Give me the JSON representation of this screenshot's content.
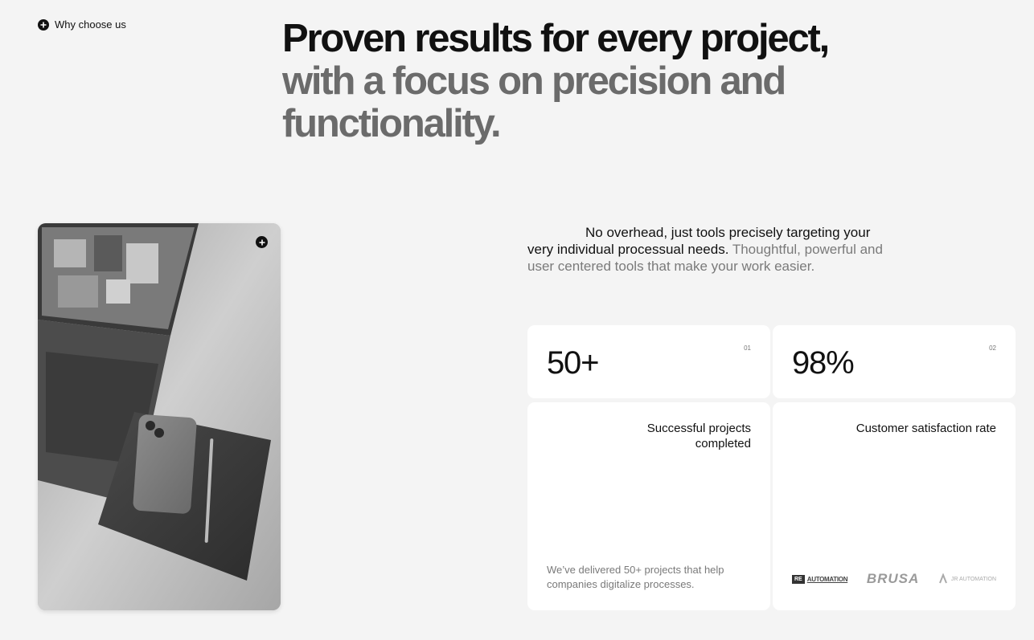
{
  "section": {
    "eyebrow": "Why choose us",
    "headline_dark": "Proven results for every project,",
    "headline_muted": "with a focus on precision and functionality."
  },
  "intro": {
    "lead": "No overhead, just tools precisely targeting your very individual processual needs.",
    "rest": "Thoughtful, powerful and user centered tools that make your work easier."
  },
  "stats": [
    {
      "value": "50+",
      "index": "01",
      "title": "Successful projects completed",
      "note": "We’ve delivered 50+ projects that help companies digitalize processes."
    },
    {
      "value": "98%",
      "index": "02",
      "title": "Customer satisfaction rate",
      "logos": [
        {
          "name": "RE AUTOMATION",
          "mark": "RE",
          "word": "AUTOMATION"
        },
        {
          "name": "BRUSA",
          "word": "BRUSA"
        },
        {
          "name": "JR AUTOMATION",
          "word": "JR AUTOMATION"
        }
      ]
    }
  ],
  "icons": {
    "eyebrow_icon": "plus-circle-icon",
    "photo_icon": "plus-circle-icon"
  },
  "colors": {
    "background": "#f4f4f4",
    "card": "#ffffff",
    "text_dark": "#111111",
    "text_muted": "#6b6b6b"
  }
}
